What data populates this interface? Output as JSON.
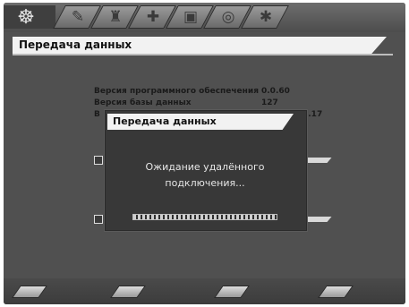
{
  "header": {
    "icons": [
      "satellite-icon",
      "tools-icon",
      "antenna-icon",
      "wrench-icon",
      "tv-icon",
      "settings-icon",
      "info-icon"
    ]
  },
  "page": {
    "title": "Передача данных"
  },
  "info": {
    "sw_label": "Версия программного обеспечения",
    "sw_value": "0.0.60",
    "db_label": "Версия базы данных",
    "db_value": "127",
    "third_label_fragment": "В",
    "third_value_fragment": "4.17"
  },
  "dialog": {
    "title": "Передача данных",
    "message_line1": "Ожидание удалённого",
    "message_line2": "подключения...",
    "progress": 1.0
  },
  "colors": {
    "background": "#505050",
    "title_bar": "#f2f2f2",
    "dialog_bg": "#383838"
  }
}
